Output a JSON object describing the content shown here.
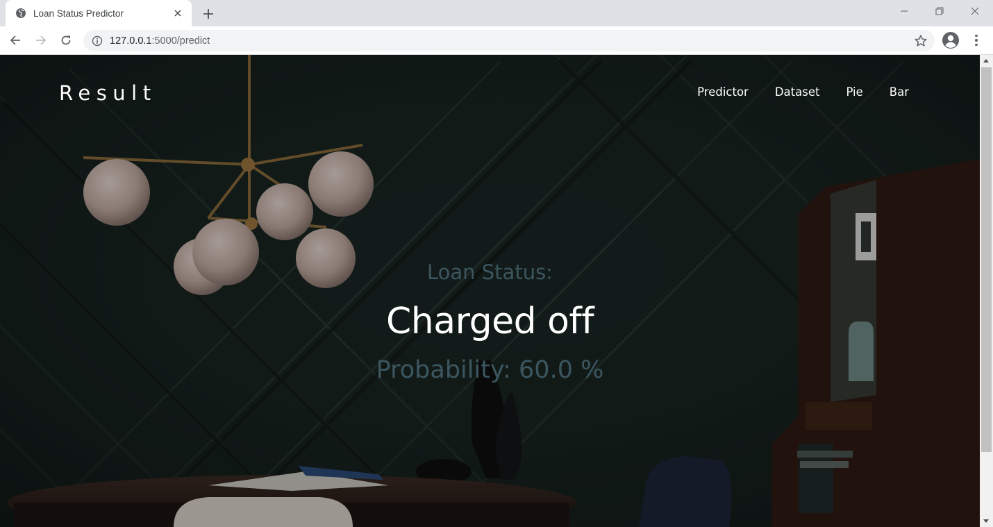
{
  "browser": {
    "tab_title": "Loan Status Predictor",
    "url_host": "127.0.0.1",
    "url_path": ":5000/predict",
    "icons": [
      "globe-icon",
      "close-icon",
      "plus-icon",
      "minimize-icon",
      "restore-icon",
      "window-close-icon",
      "back-icon",
      "forward-icon",
      "reload-icon",
      "info-icon",
      "star-icon",
      "account-icon",
      "menu-icon"
    ]
  },
  "site": {
    "brand": "Result",
    "nav": [
      {
        "label": "Predictor"
      },
      {
        "label": "Dataset"
      },
      {
        "label": "Pie"
      },
      {
        "label": "Bar"
      }
    ]
  },
  "result": {
    "status_label": "Loan Status:",
    "status_value": "Charged off",
    "probability_text": "Probability: 60.0 %"
  },
  "colors": {
    "background": "#16201d",
    "accent_text": "#3c5660",
    "primary_text": "#ffffff"
  }
}
